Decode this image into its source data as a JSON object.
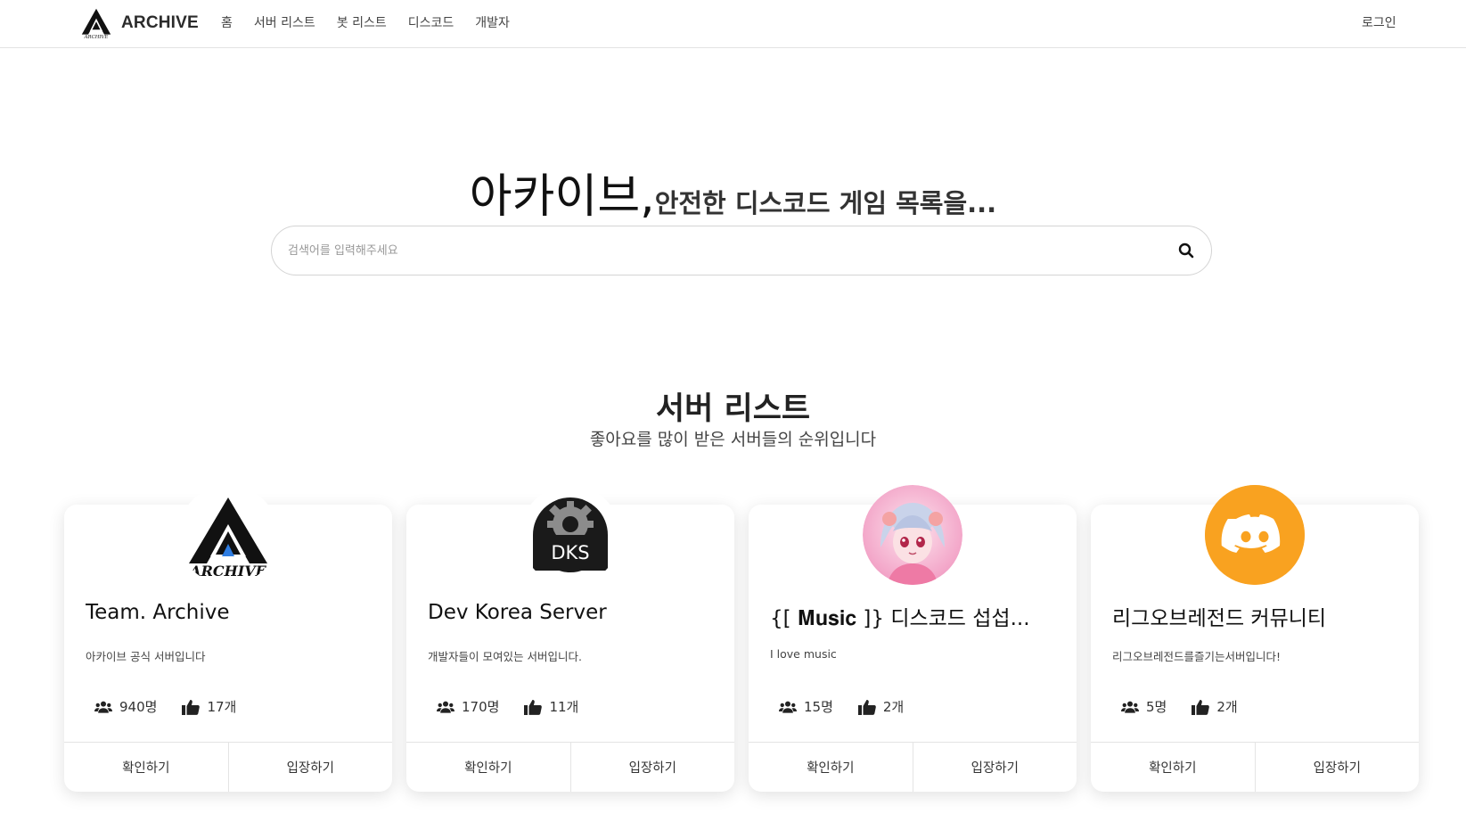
{
  "nav": {
    "brand": "ARCHIVE",
    "links": [
      "홈",
      "서버 리스트",
      "봇 리스트",
      "디스코드",
      "개발자"
    ],
    "login": "로그인"
  },
  "hero": {
    "title_big": "아카이브,",
    "title_small": "안전한 디스코드 게임 목록을...",
    "search_placeholder": "검색어를 입력해주세요"
  },
  "section": {
    "title": "서버 리스트",
    "subtitle": "좋아요를 많이 받은 서버들의 순위입니다"
  },
  "cards": [
    {
      "name": "Team. Archive",
      "desc": "아카이브 공식 서버입니다",
      "members": "940명",
      "likes": "17개",
      "avatar_text": "ARCHIVE",
      "btn_view": "확인하기",
      "btn_join": "입장하기"
    },
    {
      "name": "Dev Korea Server",
      "desc": "개발자들이 모여있는 서버입니다.",
      "members": "170명",
      "likes": "11개",
      "avatar_text": "DKS",
      "btn_view": "확인하기",
      "btn_join": "입장하기"
    },
    {
      "name": "{[ 𝐌𝐮𝐬𝐢𝐜 ]} 디스코드 섭섭...",
      "desc": "I love music",
      "members": "15명",
      "likes": "2개",
      "btn_view": "확인하기",
      "btn_join": "입장하기"
    },
    {
      "name": "리그오브레전드 커뮤니티",
      "desc": "리그오브레전드를즐기는서버입니다!",
      "members": "5명",
      "likes": "2개",
      "btn_view": "확인하기",
      "btn_join": "입장하기"
    }
  ],
  "colors": {
    "discord_orange": "#f9a220",
    "dks_black": "#1a1a1a",
    "archive_blue": "#2f7de1",
    "anime_pink": "#f3a6c8"
  }
}
